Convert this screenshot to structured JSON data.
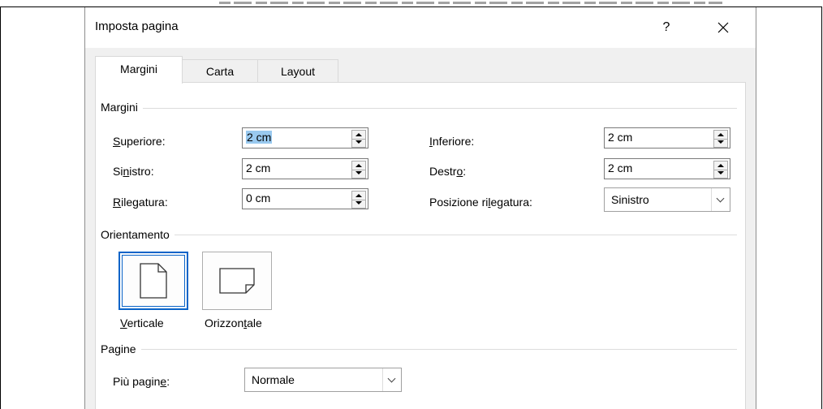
{
  "dialog": {
    "title": "Imposta pagina",
    "help_label": "?",
    "close_label": "✕"
  },
  "tabs": [
    {
      "label": "Margini",
      "active": true
    },
    {
      "label": "Carta",
      "active": false
    },
    {
      "label": "Layout",
      "active": false
    }
  ],
  "margins": {
    "group_label": "Margini",
    "top": {
      "label_u": "S",
      "label_rest": "uperiore:",
      "value": "2 cm"
    },
    "bottom": {
      "label_u": "I",
      "label_rest": "nferiore:",
      "value": "2 cm"
    },
    "left": {
      "label_pre": "Si",
      "label_u": "n",
      "label_rest": "istro:",
      "value": "2 cm"
    },
    "right": {
      "label_pre": "Destr",
      "label_u": "o",
      "label_rest": ":",
      "value": "2 cm"
    },
    "gutter": {
      "label_u": "R",
      "label_rest": "ilegatura:",
      "value": "0 cm"
    },
    "gutter_position": {
      "label_pre": "Posizione ri",
      "label_u": "l",
      "label_rest": "egatura:",
      "value": "Sinistro"
    }
  },
  "orientation": {
    "group_label": "Orientamento",
    "portrait": {
      "label_u": "V",
      "label_rest": "erticale",
      "selected": true,
      "icon": "portrait-page-icon"
    },
    "landscape": {
      "label_pre": "Orizzon",
      "label_u": "t",
      "label_rest": "ale",
      "selected": false,
      "icon": "landscape-page-icon"
    }
  },
  "pages": {
    "group_label": "Pagine",
    "multiple": {
      "label_pre": "Più pagin",
      "label_u": "e",
      "label_rest": ":",
      "value": "Normale"
    }
  },
  "colors": {
    "selection_highlight": "#99c9ef",
    "selected_border": "#0a64c8",
    "dialog_bg": "#f0f0f0"
  }
}
